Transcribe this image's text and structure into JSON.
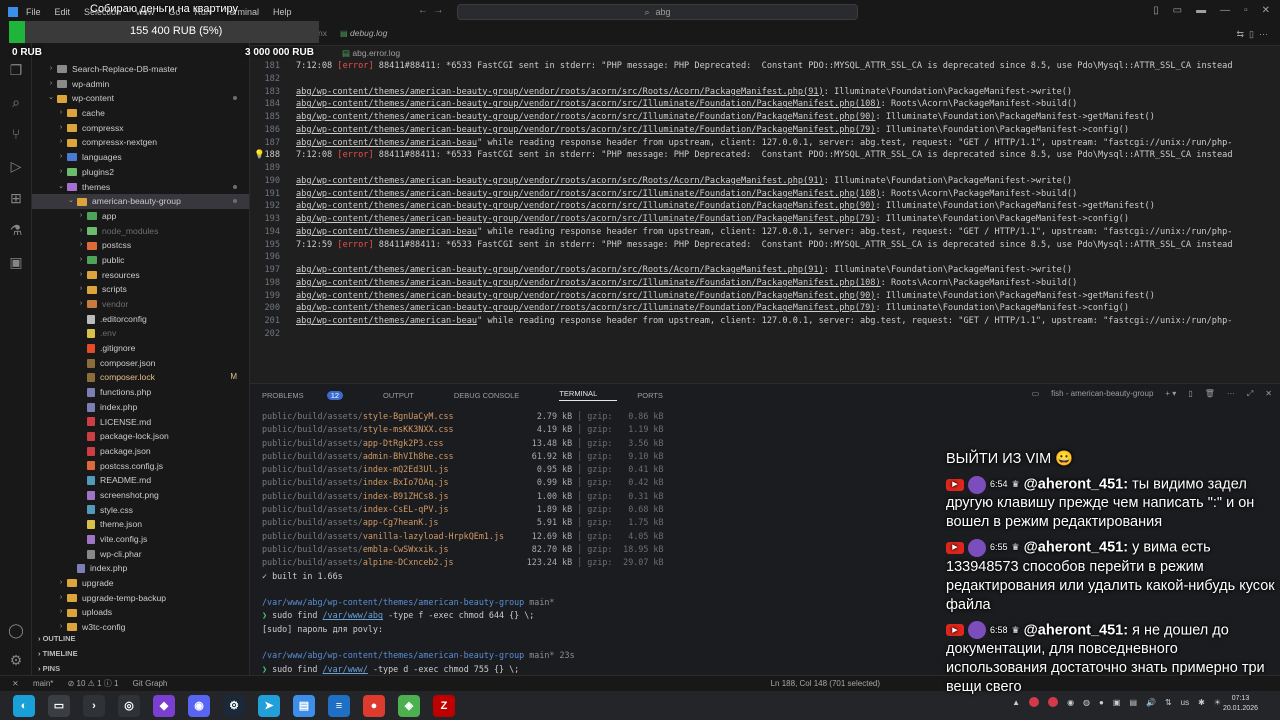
{
  "window": {
    "menu": [
      "File",
      "Edit",
      "Selection",
      "View",
      "Go",
      "Run",
      "Terminal",
      "Help"
    ],
    "search_text": "abg"
  },
  "donation": {
    "title": "Собираю деньги на квартиру",
    "current": "155 400 RUB (5%)",
    "progress_percent": 5,
    "min_label": "0 RUB",
    "max_label": "3 000 000 RUB",
    "fill_color": "#1fb53a"
  },
  "activity_icons": [
    "explorer-icon",
    "search-icon",
    "source-control-icon",
    "run-debug-icon",
    "extensions-icon",
    "testing-icon",
    "remote-icon"
  ],
  "explorer": {
    "items": [
      {
        "label": "Search-Replace-DB-master",
        "depth": 1,
        "kind": "folder",
        "color": "#8a8a8a"
      },
      {
        "label": "wp-admin",
        "depth": 1,
        "kind": "folder",
        "color": "#8a8a8a"
      },
      {
        "label": "wp-content",
        "depth": 1,
        "kind": "folder-open",
        "color": "#dca53b",
        "dot": true
      },
      {
        "label": "cache",
        "depth": 2,
        "kind": "folder",
        "color": "#dca53b"
      },
      {
        "label": "compressx",
        "depth": 2,
        "kind": "folder",
        "color": "#dca53b"
      },
      {
        "label": "compressx-nextgen",
        "depth": 2,
        "kind": "folder",
        "color": "#dca53b"
      },
      {
        "label": "languages",
        "depth": 2,
        "kind": "folder",
        "color": "#4a7bd4"
      },
      {
        "label": "plugins2",
        "depth": 2,
        "kind": "folder",
        "color": "#6cba6c"
      },
      {
        "label": "themes",
        "depth": 2,
        "kind": "folder-open",
        "color": "#a66fd0",
        "dot": true
      },
      {
        "label": "american-beauty-group",
        "depth": 3,
        "kind": "folder-open",
        "color": "#dca53b",
        "selected": true,
        "dot": true
      },
      {
        "label": "app",
        "depth": 4,
        "kind": "folder",
        "color": "#4ea35a"
      },
      {
        "label": "node_modules",
        "depth": 4,
        "kind": "folder",
        "color": "#6cba6c",
        "dim": true
      },
      {
        "label": "postcss",
        "depth": 4,
        "kind": "folder",
        "color": "#dd6b3a"
      },
      {
        "label": "public",
        "depth": 4,
        "kind": "folder",
        "color": "#4ea35a"
      },
      {
        "label": "resources",
        "depth": 4,
        "kind": "folder",
        "color": "#dca53b"
      },
      {
        "label": "scripts",
        "depth": 4,
        "kind": "folder",
        "color": "#dca53b"
      },
      {
        "label": "vendor",
        "depth": 4,
        "kind": "folder",
        "color": "#c77b3d",
        "dim": true
      },
      {
        "label": ".editorconfig",
        "depth": 4,
        "kind": "file",
        "color": "#bbbbbb"
      },
      {
        "label": ".env",
        "depth": 4,
        "kind": "file",
        "color": "#d9c148",
        "dim": true
      },
      {
        "label": ".gitignore",
        "depth": 4,
        "kind": "file",
        "color": "#e34c26"
      },
      {
        "label": "composer.json",
        "depth": 4,
        "kind": "file",
        "color": "#8a6d3b"
      },
      {
        "label": "composer.lock",
        "depth": 4,
        "kind": "file",
        "color": "#8a6d3b",
        "modified": true,
        "badge": "M"
      },
      {
        "label": "functions.php",
        "depth": 4,
        "kind": "file",
        "color": "#7b7fb5"
      },
      {
        "label": "index.php",
        "depth": 4,
        "kind": "file",
        "color": "#7b7fb5"
      },
      {
        "label": "LICENSE.md",
        "depth": 4,
        "kind": "file",
        "color": "#cc3e44"
      },
      {
        "label": "package-lock.json",
        "depth": 4,
        "kind": "file",
        "color": "#cc3e44"
      },
      {
        "label": "package.json",
        "depth": 4,
        "kind": "file",
        "color": "#cc3e44"
      },
      {
        "label": "postcss.config.js",
        "depth": 4,
        "kind": "file",
        "color": "#dd6b3a"
      },
      {
        "label": "README.md",
        "depth": 4,
        "kind": "file",
        "color": "#519aba"
      },
      {
        "label": "screenshot.png",
        "depth": 4,
        "kind": "file",
        "color": "#a074c4"
      },
      {
        "label": "style.css",
        "depth": 4,
        "kind": "file",
        "color": "#519aba"
      },
      {
        "label": "theme.json",
        "depth": 4,
        "kind": "file",
        "color": "#d9c148"
      },
      {
        "label": "vite.config.js",
        "depth": 4,
        "kind": "file",
        "color": "#a074c4"
      },
      {
        "label": "wp-cli.phar",
        "depth": 4,
        "kind": "file",
        "color": "#888888"
      },
      {
        "label": "index.php",
        "depth": 3,
        "kind": "file",
        "color": "#7b7fb5"
      },
      {
        "label": "upgrade",
        "depth": 2,
        "kind": "folder",
        "color": "#dca53b"
      },
      {
        "label": "upgrade-temp-backup",
        "depth": 2,
        "kind": "folder",
        "color": "#dca53b"
      },
      {
        "label": "uploads",
        "depth": 2,
        "kind": "folder",
        "color": "#dca53b"
      },
      {
        "label": "w3tc-config",
        "depth": 2,
        "kind": "folder",
        "color": "#dca53b"
      }
    ],
    "sections": [
      "OUTLINE",
      "TIMELINE",
      "PINS"
    ]
  },
  "editor": {
    "tab_label": "debug.log",
    "tab_left_label": "nx",
    "breadcrumb": "abg.error.log",
    "lines": [
      {
        "n": "181",
        "segs": [
          {
            "t": "7:12:08 "
          },
          {
            "t": "[error]",
            "c": "err"
          },
          {
            "t": " 88411#88411: *6533 FastCGI sent in stderr: \"PHP message: PHP Deprecated:  Constant PDO::MYSQL_ATTR_SSL_CA is deprecated since 8.5, use Pdo\\Mysql::ATTR_SSL_CA instead"
          }
        ]
      },
      {
        "n": "182",
        "segs": []
      },
      {
        "n": "183",
        "segs": [
          {
            "t": "abg/wp-content/themes/american-beauty-group/vendor/roots/acorn/src/Roots/Acorn/PackageManifest.php(91)",
            "c": "u"
          },
          {
            "t": ": Illuminate\\Foundation\\PackageManifest->write()"
          }
        ]
      },
      {
        "n": "184",
        "segs": [
          {
            "t": "abg/wp-content/themes/american-beauty-group/vendor/roots/acorn/src/Illuminate/Foundation/PackageManifest.php(108)",
            "c": "u"
          },
          {
            "t": ": Roots\\Acorn\\PackageManifest->build()"
          }
        ]
      },
      {
        "n": "185",
        "segs": [
          {
            "t": "abg/wp-content/themes/american-beauty-group/vendor/roots/acorn/src/Illuminate/Foundation/PackageManifest.php(90)",
            "c": "u"
          },
          {
            "t": ": Illuminate\\Foundation\\PackageManifest->getManifest()"
          }
        ]
      },
      {
        "n": "186",
        "segs": [
          {
            "t": "abg/wp-content/themes/american-beauty-group/vendor/roots/acorn/src/Illuminate/Foundation/PackageManifest.php(79)",
            "c": "u"
          },
          {
            "t": ": Illuminate\\Foundation\\PackageManifest->config()"
          }
        ]
      },
      {
        "n": "187",
        "segs": [
          {
            "t": "abg/wp-content/themes/american-beau",
            "c": "u"
          },
          {
            "t": "\" while reading response header from upstream, client: 127.0.0.1, server: abg.test, request: \"GET / HTTP/1.1\", upstream: \"fastcgi://unix:/run/php-"
          }
        ]
      },
      {
        "n": "188",
        "cur": true,
        "segs": [
          {
            "t": "7:12:08 "
          },
          {
            "t": "[error]",
            "c": "err"
          },
          {
            "t": " 88411#88411: *6533 FastCGI sent in stderr: \"PHP message: PHP Deprecated:  Constant PDO::MYSQL_ATTR_SSL_CA is deprecated since 8.5, use Pdo\\Mysql::ATTR_SSL_CA instead"
          }
        ]
      },
      {
        "n": "189",
        "segs": []
      },
      {
        "n": "190",
        "segs": [
          {
            "t": "abg/wp-content/themes/american-beauty-group/vendor/roots/acorn/src/Roots/Acorn/PackageManifest.php(91)",
            "c": "u"
          },
          {
            "t": ": Illuminate\\Foundation\\PackageManifest->write()"
          }
        ]
      },
      {
        "n": "191",
        "segs": [
          {
            "t": "abg/wp-content/themes/american-beauty-group/vendor/roots/acorn/src/Illuminate/Foundation/PackageManifest.php(108)",
            "c": "u"
          },
          {
            "t": ": Roots\\Acorn\\PackageManifest->build()"
          }
        ]
      },
      {
        "n": "192",
        "segs": [
          {
            "t": "abg/wp-content/themes/american-beauty-group/vendor/roots/acorn/src/Illuminate/Foundation/PackageManifest.php(90)",
            "c": "u"
          },
          {
            "t": ": Illuminate\\Foundation\\PackageManifest->getManifest()"
          }
        ]
      },
      {
        "n": "193",
        "segs": [
          {
            "t": "abg/wp-content/themes/american-beauty-group/vendor/roots/acorn/src/Illuminate/Foundation/PackageManifest.php(79)",
            "c": "u"
          },
          {
            "t": ": Illuminate\\Foundation\\PackageManifest->config()"
          }
        ]
      },
      {
        "n": "194",
        "segs": [
          {
            "t": "abg/wp-content/themes/american-beau",
            "c": "u"
          },
          {
            "t": "\" while reading response header from upstream, client: 127.0.0.1, server: abg.test, request: \"GET / HTTP/1.1\", upstream: \"fastcgi://unix:/run/php-"
          }
        ]
      },
      {
        "n": "195",
        "segs": [
          {
            "t": "7:12:59 "
          },
          {
            "t": "[error]",
            "c": "err"
          },
          {
            "t": " 88411#88411: *6533 FastCGI sent in stderr: \"PHP message: PHP Deprecated:  Constant PDO::MYSQL_ATTR_SSL_CA is deprecated since 8.5, use Pdo\\Mysql::ATTR_SSL_CA instead"
          }
        ]
      },
      {
        "n": "196",
        "segs": []
      },
      {
        "n": "197",
        "segs": [
          {
            "t": "abg/wp-content/themes/american-beauty-group/vendor/roots/acorn/src/Roots/Acorn/PackageManifest.php(91)",
            "c": "u"
          },
          {
            "t": ": Illuminate\\Foundation\\PackageManifest->write()"
          }
        ]
      },
      {
        "n": "198",
        "segs": [
          {
            "t": "abg/wp-content/themes/american-beauty-group/vendor/roots/acorn/src/Illuminate/Foundation/PackageManifest.php(108)",
            "c": "u"
          },
          {
            "t": ": Roots\\Acorn\\PackageManifest->build()"
          }
        ]
      },
      {
        "n": "199",
        "segs": [
          {
            "t": "abg/wp-content/themes/american-beauty-group/vendor/roots/acorn/src/Illuminate/Foundation/PackageManifest.php(90)",
            "c": "u"
          },
          {
            "t": ": Illuminate\\Foundation\\PackageManifest->getManifest()"
          }
        ]
      },
      {
        "n": "200",
        "segs": [
          {
            "t": "abg/wp-content/themes/american-beauty-group/vendor/roots/acorn/src/Illuminate/Foundation/PackageManifest.php(79)",
            "c": "u"
          },
          {
            "t": ": Illuminate\\Foundation\\PackageManifest->config()"
          }
        ]
      },
      {
        "n": "201",
        "segs": [
          {
            "t": "abg/wp-content/themes/american-beau",
            "c": "u"
          },
          {
            "t": "\" while reading response header from upstream, client: 127.0.0.1, server: abg.test, request: \"GET / HTTP/1.1\", upstream: \"fastcgi://unix:/run/php-"
          }
        ]
      },
      {
        "n": "202",
        "segs": []
      }
    ]
  },
  "panel": {
    "tabs": [
      {
        "label": "PROBLEMS",
        "count": "12"
      },
      {
        "label": "OUTPUT"
      },
      {
        "label": "DEBUG CONSOLE"
      },
      {
        "label": "TERMINAL",
        "active": true
      },
      {
        "label": "PORTS"
      }
    ],
    "terminal_name": "fish - american-beauty-group",
    "assets": [
      {
        "file": "style-BgnUaCyM.css",
        "size": "2.79 kB",
        "gzip": "0.86 kB"
      },
      {
        "file": "style-msKK3NXX.css",
        "size": "4.19 kB",
        "gzip": "1.19 kB"
      },
      {
        "file": "app-DtRgk2P3.css",
        "size": "13.48 kB",
        "gzip": "3.56 kB"
      },
      {
        "file": "admin-BhVIh8he.css",
        "size": "61.92 kB",
        "gzip": "9.10 kB"
      },
      {
        "file": "index-mQ2Ed3Ul.js",
        "size": "0.95 kB",
        "gzip": "0.41 kB"
      },
      {
        "file": "index-BxIo7OAq.js",
        "size": "0.99 kB",
        "gzip": "0.42 kB"
      },
      {
        "file": "index-B91ZHCs8.js",
        "size": "1.00 kB",
        "gzip": "0.31 kB"
      },
      {
        "file": "index-CsEL-qPV.js",
        "size": "1.89 kB",
        "gzip": "0.68 kB"
      },
      {
        "file": "app-Cg7heanK.js",
        "size": "5.91 kB",
        "gzip": "1.75 kB"
      },
      {
        "file": "vanilla-lazyload-HrpkQEm1.js",
        "size": "12.69 kB",
        "gzip": "4.05 kB"
      },
      {
        "file": "embla-CwSWxxik.js",
        "size": "82.70 kB",
        "gzip": "18.95 kB"
      },
      {
        "file": "alpine-DCxnceb2.js",
        "size": "123.24 kB",
        "gzip": "29.07 kB"
      }
    ],
    "asset_prefix": "public/build/assets/",
    "built": "✓ built in 1.66s",
    "prompt1_path": "/var/www/abg/wp-content/themes/american-beauty-group",
    "prompt1_branch": "main*",
    "cmd1_a": "sudo find ",
    "cmd1_path": "/var/www/abg",
    "cmd1_b": " -type f -exec chmod 644 {} \\;",
    "sudo_prompt": "[sudo] пароль для povly:",
    "prompt2_path": "/var/www/abg/wp-content/themes/american-beauty-group",
    "prompt2_branch": "main* 23s",
    "cmd2_a": "sudo find ",
    "cmd2_path": "/var/www/",
    "cmd2_b": " -type d -exec chmod 755 {} \\;"
  },
  "statusbar": {
    "branch": "main*",
    "problems": "⊘ 10 ⚠ 1 ⓘ 1",
    "git_graph": "Git Graph",
    "position": "Ln 188, Col 148 (701 selected)"
  },
  "chat": {
    "header": "ВЫЙТИ ИЗ VIM 😀",
    "messages": [
      {
        "time": "6:54",
        "author": "@aheront_451:",
        "text": "ты видимо задел другую клавишу прежде чем написать \":\" и он вошел в режим редактирования"
      },
      {
        "time": "6:55",
        "author": "@aheront_451:",
        "text": "у вима есть 133948573 способов перейти в режим редактирования или удалить какой-нибудь кусок файла"
      },
      {
        "time": "6:58",
        "author": "@aheront_451:",
        "text": "я не дошел до документации, для повседневного использования достаточно знать примерно три вещи свего"
      }
    ]
  },
  "taskbar": {
    "apps": [
      {
        "name": "kde-menu-icon",
        "glyph": "◐",
        "color": "#1aa0d8"
      },
      {
        "name": "task-switcher-icon",
        "glyph": "▭",
        "color": "#3a3d42"
      },
      {
        "name": "terminal-icon",
        "glyph": "›",
        "color": "#2f3237"
      },
      {
        "name": "steam-alt-icon",
        "glyph": "◎",
        "color": "#2f3237"
      },
      {
        "name": "obsidian-icon",
        "glyph": "◆",
        "color": "#7a3fd1"
      },
      {
        "name": "discord-icon",
        "glyph": "◉",
        "color": "#5865f2"
      },
      {
        "name": "steam-icon",
        "glyph": "⚙",
        "color": "#1b2838"
      },
      {
        "name": "telegram-icon",
        "glyph": "➤",
        "color": "#229ed9"
      },
      {
        "name": "files-icon",
        "glyph": "▤",
        "color": "#3b8eea"
      },
      {
        "name": "vscode-icon",
        "glyph": "≡",
        "color": "#1f6fc4"
      },
      {
        "name": "chrome-icon",
        "glyph": "●",
        "color": "#de3b2f"
      },
      {
        "name": "git-tool-icon",
        "glyph": "◈",
        "color": "#4caf50"
      },
      {
        "name": "filezilla-icon",
        "glyph": "Z",
        "color": "#bf0000"
      }
    ],
    "lang": "us",
    "time": "07:13",
    "date": "20.01.2026"
  }
}
